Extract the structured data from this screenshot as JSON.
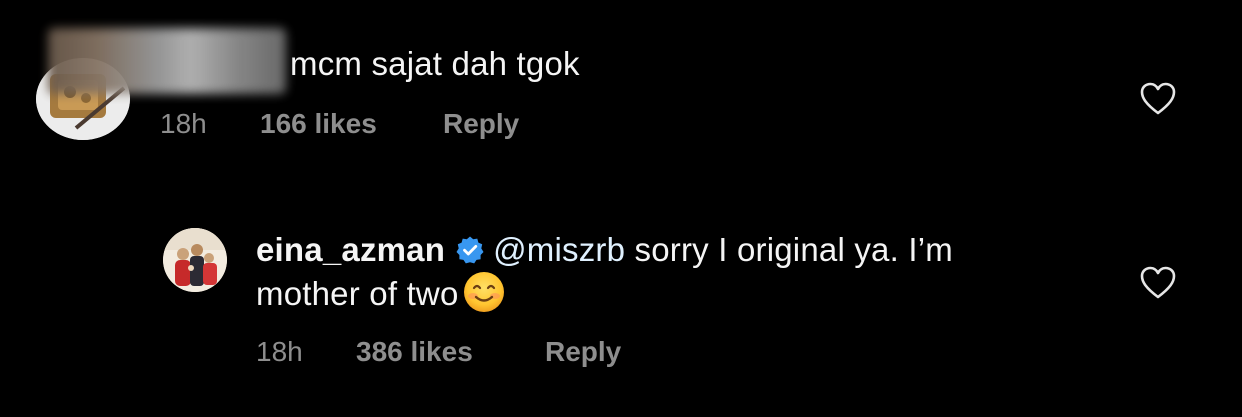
{
  "comments": [
    {
      "username": "",
      "text": "mcm sajat dah tgok",
      "time": "18h",
      "likes": "166 likes",
      "reply": "Reply"
    },
    {
      "username": "eina_azman",
      "verified": true,
      "mention": "@miszrb",
      "text_line1": " sorry I original ya. I’m",
      "text_line2": "mother of two",
      "emoji": "smiling-face-emoji",
      "time": "18h",
      "likes": "386 likes",
      "reply": "Reply"
    }
  ],
  "icons": {
    "like": "heart-icon",
    "verified": "verified-badge-icon"
  },
  "colors": {
    "background": "#000000",
    "primary_text": "#f5f5f5",
    "secondary_text": "#8e8e8e",
    "verified_blue": "#3897f0"
  }
}
